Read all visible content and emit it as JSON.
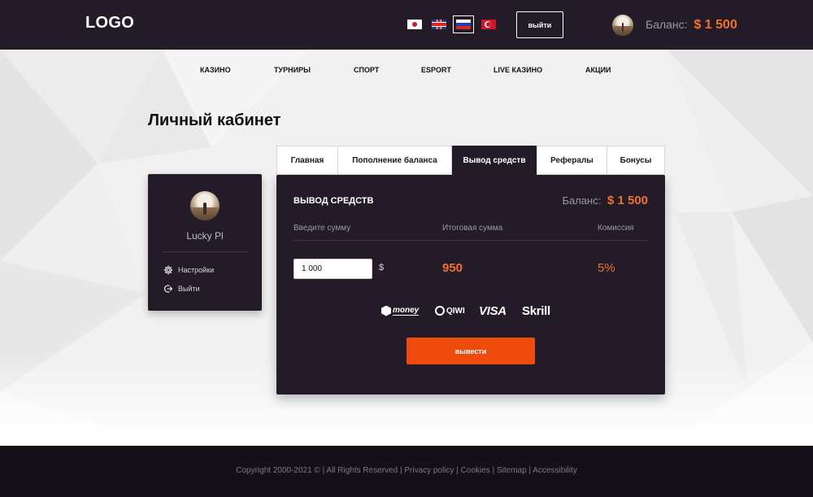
{
  "header": {
    "logo": "LOGO",
    "languages": [
      {
        "code": "ja",
        "icon": "japan-flag-icon"
      },
      {
        "code": "en",
        "icon": "uk-flag-icon"
      },
      {
        "code": "ru",
        "icon": "russia-flag-icon",
        "active": true
      },
      {
        "code": "tr",
        "icon": "turkey-flag-icon"
      }
    ],
    "logout_label": "выйти",
    "balance_label": "Баланс:",
    "balance_value": "$ 1 500"
  },
  "nav": {
    "items": [
      "КАЗИНО",
      "ТУРНИРЫ",
      "СПОРТ",
      "ESPORT",
      "LIVE КАЗИНО",
      "АКЦИИ"
    ]
  },
  "page": {
    "title": "Личный кабинет"
  },
  "profile": {
    "name": "Lucky Pl",
    "links": [
      {
        "label": "Настройки",
        "icon": "gear-icon"
      },
      {
        "label": "Выйти",
        "icon": "logout-icon"
      }
    ]
  },
  "tabs": [
    {
      "label": "Главная"
    },
    {
      "label": "Пополнение баланса"
    },
    {
      "label": "Вывод средств",
      "active": true
    },
    {
      "label": "Рефералы"
    },
    {
      "label": "Бонусы"
    }
  ],
  "withdraw": {
    "title": "ВЫВОД СРЕДСТВ",
    "balance_label": "Баланс:",
    "balance_value": "$ 1 500",
    "columns": {
      "amount": "Введите сумму",
      "total": "Итоговая сумма",
      "commission": "Комиссия"
    },
    "amount_value": "1 000",
    "currency": "$",
    "total_value": "950",
    "commission_value": "5%",
    "payment_methods": {
      "money": "money",
      "qiwi": "QIWI",
      "visa": "VISA",
      "skrill": "Skrill"
    },
    "submit_label": "вывести"
  },
  "footer": {
    "copyright": "Copyright 2000-2021 © | All Rights Reserved | ",
    "links": [
      "Privacy policy",
      "Cookies",
      "Sitemap",
      "Accessibility"
    ]
  },
  "colors": {
    "dark": "#231c28",
    "accent": "#f0702a",
    "button": "#ee4a0c",
    "footer": "#140f19"
  }
}
